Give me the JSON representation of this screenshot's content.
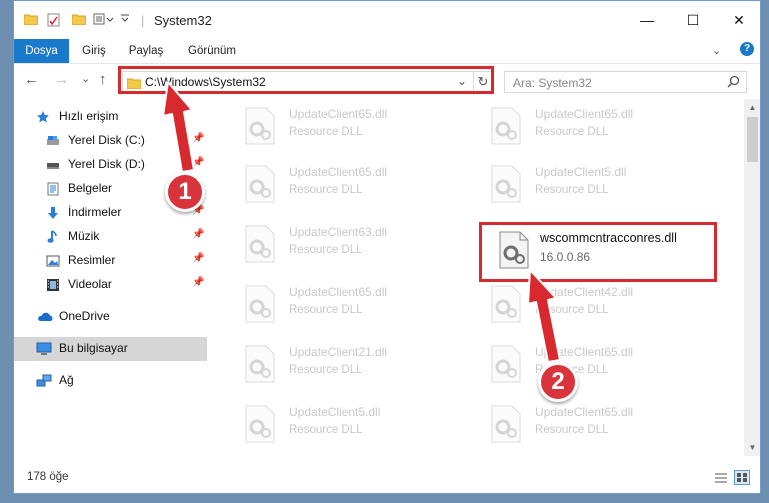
{
  "window": {
    "title": "System32",
    "controls": {
      "minimize": "—",
      "maximize": "☐",
      "close": "✕"
    }
  },
  "ribbon": {
    "tabs": [
      "Dosya",
      "Giriş",
      "Paylaş",
      "Görünüm"
    ],
    "active_tab": "Dosya"
  },
  "navigation": {
    "back": "←",
    "forward": "→",
    "recent": "⌄",
    "up": "↑",
    "address": "C:\\Windows\\System32",
    "search_placeholder": "Ara: System32"
  },
  "sidebar": {
    "items": [
      {
        "label": "Hızlı erişim",
        "icon": "star-icon"
      },
      {
        "label": "Yerel Disk (C:)",
        "icon": "drive-icon"
      },
      {
        "label": "Yerel Disk (D:)",
        "icon": "drive-icon"
      },
      {
        "label": "Belgeler",
        "icon": "documents-icon"
      },
      {
        "label": "İndirmeler",
        "icon": "downloads-icon"
      },
      {
        "label": "Müzik",
        "icon": "music-icon"
      },
      {
        "label": "Resimler",
        "icon": "pictures-icon"
      },
      {
        "label": "Videolar",
        "icon": "videos-icon"
      },
      {
        "label": "OneDrive",
        "icon": "cloud-icon"
      },
      {
        "label": "Bu bilgisayar",
        "icon": "computer-icon"
      },
      {
        "label": "Ağ",
        "icon": "network-icon"
      }
    ]
  },
  "files": {
    "left": [
      {
        "name": "UpdateClient65.dll",
        "type": "Resource DLL"
      },
      {
        "name": "UpdateClient65.dll",
        "type": "Resource DLL"
      },
      {
        "name": "UpdateClient63.dll",
        "type": "Resource DLL"
      },
      {
        "name": "UpdateClient65.dll",
        "type": "Resource DLL"
      },
      {
        "name": "UpdateClient21.dll",
        "type": "Resource DLL"
      },
      {
        "name": "UpdateClient5.dll",
        "type": "Resource DLL"
      }
    ],
    "right": [
      {
        "name": "UpdateClient65.dll",
        "type": "Resource DLL"
      },
      {
        "name": "UpdateClient5.dll",
        "type": "Resource DLL"
      },
      {
        "name": "wscommcntracconres.dll",
        "type": "16.0.0.86"
      },
      {
        "name": "UpdateClient42.dll",
        "type": "Resource DLL"
      },
      {
        "name": "UpdateClient65.dll",
        "type": "Resource DLL"
      },
      {
        "name": "UpdateClient65.dll",
        "type": "Resource DLL"
      }
    ]
  },
  "status": {
    "item_count": "178 öğe"
  },
  "annotations": {
    "step1": "1",
    "step2": "2"
  },
  "colors": {
    "accent": "#1979ca",
    "highlight_red": "#d8292f"
  }
}
